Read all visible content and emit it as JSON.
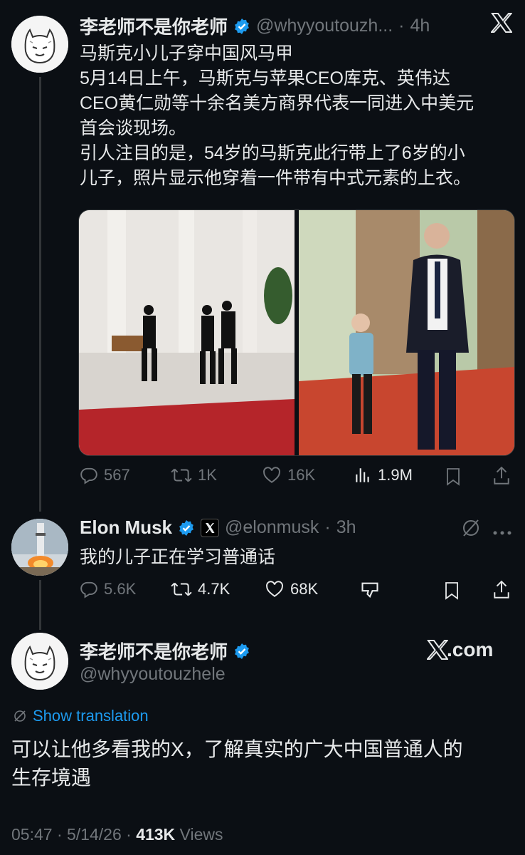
{
  "tweet1": {
    "author_name": "李老师不是你老师",
    "handle": "@whyyoutouzh...",
    "time": "4h",
    "lines": [
      "马斯克小儿子穿中国风马甲",
      "5月14日上午，马斯克与苹果CEO库克、英伟达",
      "CEO黄仁勋等十余名美方商界代表一同进入中美元",
      "首会谈现场。",
      "引人注目的是，54岁的马斯克此行带上了6岁的小",
      "儿子，照片显示他穿着一件带有中式元素的上衣。"
    ],
    "actions": {
      "replies": "567",
      "reposts": "1K",
      "likes": "16K",
      "views": "1.9M"
    }
  },
  "tweet2": {
    "author_name": "Elon Musk",
    "handle": "@elonmusk",
    "time": "3h",
    "text": "我的儿子正在学习普通话",
    "actions": {
      "replies": "5.6K",
      "reposts": "4.7K",
      "likes": "68K"
    }
  },
  "tweet3": {
    "author_name": "李老师不是你老师",
    "handle": "@whyyoutouzhele",
    "brand": "X.com",
    "show_translation": "Show translation",
    "lines": [
      "可以让他多看我的X，了解真实的广大中国普通人的",
      "生存境遇"
    ],
    "timestamp": "05:47 · 5/14/26 · ",
    "views_count": "413K",
    "views_label": " Views"
  },
  "colors": {
    "background": "#0b0f14",
    "text": "#e7e9ea",
    "muted": "#71767b",
    "verified": "#1d9bf0",
    "link": "#1d9bf0"
  }
}
